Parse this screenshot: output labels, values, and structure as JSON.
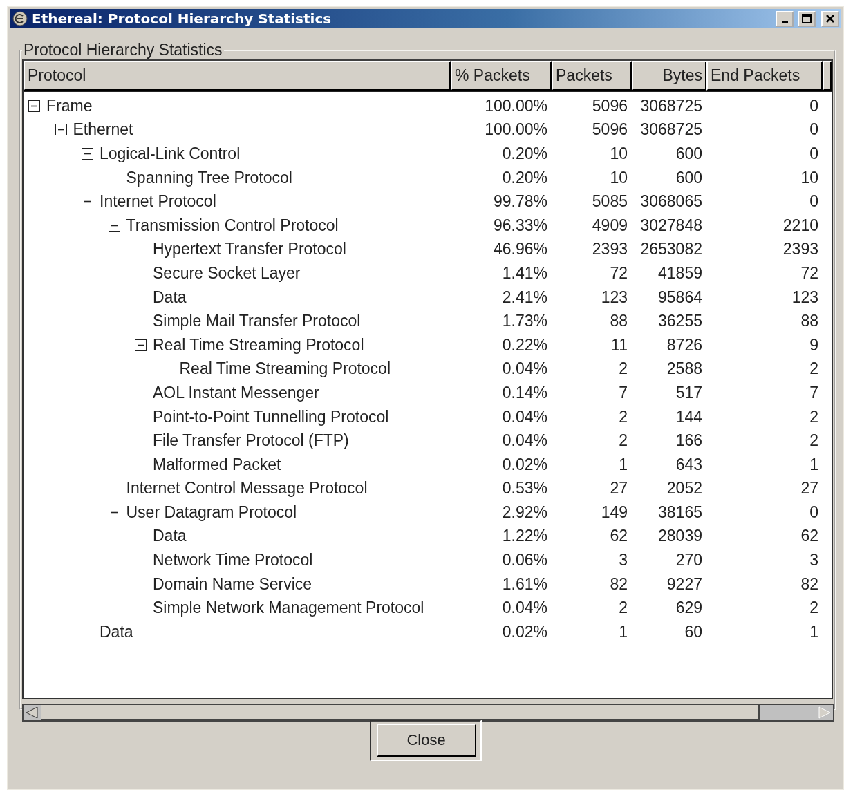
{
  "window": {
    "title": "Ethereal: Protocol Hierarchy Statistics"
  },
  "group_title": "Protocol Hierarchy Statistics",
  "table": {
    "columns": [
      "Protocol",
      "% Packets",
      "Packets",
      "Bytes",
      "End Packets"
    ],
    "rows": [
      {
        "protocol": "Frame",
        "pct_packets": "100.00%",
        "packets": "5096",
        "bytes": "3068725",
        "end_packets": "0",
        "expanded": true,
        "children": [
          {
            "protocol": "Ethernet",
            "pct_packets": "100.00%",
            "packets": "5096",
            "bytes": "3068725",
            "end_packets": "0",
            "expanded": true,
            "children": [
              {
                "protocol": "Logical-Link Control",
                "pct_packets": "0.20%",
                "packets": "10",
                "bytes": "600",
                "end_packets": "0",
                "expanded": true,
                "children": [
                  {
                    "protocol": "Spanning Tree Protocol",
                    "pct_packets": "0.20%",
                    "packets": "10",
                    "bytes": "600",
                    "end_packets": "10"
                  }
                ]
              },
              {
                "protocol": "Internet Protocol",
                "pct_packets": "99.78%",
                "packets": "5085",
                "bytes": "3068065",
                "end_packets": "0",
                "expanded": true,
                "children": [
                  {
                    "protocol": "Transmission Control Protocol",
                    "pct_packets": "96.33%",
                    "packets": "4909",
                    "bytes": "3027848",
                    "end_packets": "2210",
                    "expanded": true,
                    "children": [
                      {
                        "protocol": "Hypertext Transfer Protocol",
                        "pct_packets": "46.96%",
                        "packets": "2393",
                        "bytes": "2653082",
                        "end_packets": "2393"
                      },
                      {
                        "protocol": "Secure Socket Layer",
                        "pct_packets": "1.41%",
                        "packets": "72",
                        "bytes": "41859",
                        "end_packets": "72"
                      },
                      {
                        "protocol": "Data",
                        "pct_packets": "2.41%",
                        "packets": "123",
                        "bytes": "95864",
                        "end_packets": "123"
                      },
                      {
                        "protocol": "Simple Mail Transfer Protocol",
                        "pct_packets": "1.73%",
                        "packets": "88",
                        "bytes": "36255",
                        "end_packets": "88"
                      },
                      {
                        "protocol": "Real Time Streaming Protocol",
                        "pct_packets": "0.22%",
                        "packets": "11",
                        "bytes": "8726",
                        "end_packets": "9",
                        "expanded": true,
                        "children": [
                          {
                            "protocol": "Real Time Streaming Protocol",
                            "pct_packets": "0.04%",
                            "packets": "2",
                            "bytes": "2588",
                            "end_packets": "2"
                          }
                        ]
                      },
                      {
                        "protocol": "AOL Instant Messenger",
                        "pct_packets": "0.14%",
                        "packets": "7",
                        "bytes": "517",
                        "end_packets": "7"
                      },
                      {
                        "protocol": "Point-to-Point Tunnelling Protocol",
                        "pct_packets": "0.04%",
                        "packets": "2",
                        "bytes": "144",
                        "end_packets": "2"
                      },
                      {
                        "protocol": "File Transfer Protocol (FTP)",
                        "pct_packets": "0.04%",
                        "packets": "2",
                        "bytes": "166",
                        "end_packets": "2"
                      },
                      {
                        "protocol": "Malformed Packet",
                        "pct_packets": "0.02%",
                        "packets": "1",
                        "bytes": "643",
                        "end_packets": "1"
                      }
                    ]
                  },
                  {
                    "protocol": "Internet Control Message Protocol",
                    "pct_packets": "0.53%",
                    "packets": "27",
                    "bytes": "2052",
                    "end_packets": "27"
                  },
                  {
                    "protocol": "User Datagram Protocol",
                    "pct_packets": "2.92%",
                    "packets": "149",
                    "bytes": "38165",
                    "end_packets": "0",
                    "expanded": true,
                    "children": [
                      {
                        "protocol": "Data",
                        "pct_packets": "1.22%",
                        "packets": "62",
                        "bytes": "28039",
                        "end_packets": "62"
                      },
                      {
                        "protocol": "Network Time Protocol",
                        "pct_packets": "0.06%",
                        "packets": "3",
                        "bytes": "270",
                        "end_packets": "3"
                      },
                      {
                        "protocol": "Domain Name Service",
                        "pct_packets": "1.61%",
                        "packets": "82",
                        "bytes": "9227",
                        "end_packets": "82"
                      },
                      {
                        "protocol": "Simple Network Management Protocol",
                        "pct_packets": "0.04%",
                        "packets": "2",
                        "bytes": "629",
                        "end_packets": "2"
                      }
                    ]
                  }
                ]
              },
              {
                "protocol": "Data",
                "pct_packets": "0.02%",
                "packets": "1",
                "bytes": "60",
                "end_packets": "1"
              }
            ]
          }
        ]
      }
    ]
  },
  "buttons": [
    "Close"
  ]
}
